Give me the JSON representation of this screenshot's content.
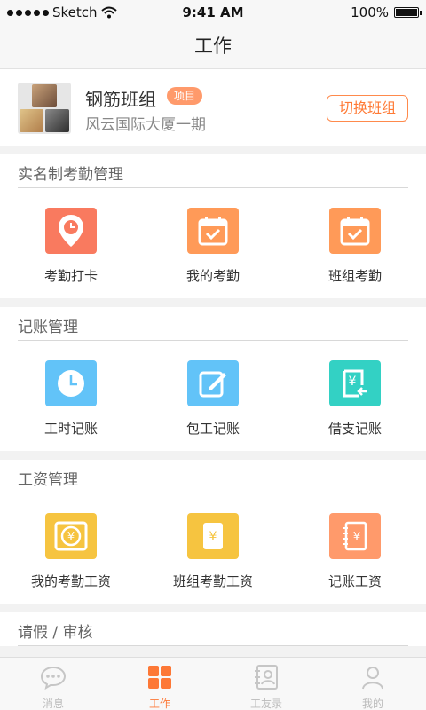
{
  "status": {
    "carrier": "Sketch",
    "time": "9:41 AM",
    "battery": "100%"
  },
  "nav": {
    "title": "工作"
  },
  "team": {
    "name": "钢筋班组",
    "tag": "项目",
    "site": "风云国际大厦一期",
    "switch_label": "切换班组"
  },
  "sections": [
    {
      "title": "实名制考勤管理",
      "items": [
        {
          "label": "考勤打卡",
          "icon": "location-clock-icon",
          "color": "#f97a5f"
        },
        {
          "label": "我的考勤",
          "icon": "calendar-check-icon",
          "color": "#ff9a58"
        },
        {
          "label": "班组考勤",
          "icon": "calendar-check-icon",
          "color": "#ff9a58"
        }
      ]
    },
    {
      "title": "记账管理",
      "items": [
        {
          "label": "工时记账",
          "icon": "clock-icon",
          "color": "#62c3f8"
        },
        {
          "label": "包工记账",
          "icon": "edit-icon",
          "color": "#62c3f8"
        },
        {
          "label": "借支记账",
          "icon": "yuan-return-icon",
          "color": "#33d1c4"
        }
      ]
    },
    {
      "title": "工资管理",
      "items": [
        {
          "label": "我的考勤工资",
          "icon": "yuan-cycle-icon",
          "color": "#f6c440"
        },
        {
          "label": "班组考勤工资",
          "icon": "yuan-book-icon",
          "color": "#f6c440"
        },
        {
          "label": "记账工资",
          "icon": "yuan-notebook-icon",
          "color": "#ff9a6b"
        }
      ]
    },
    {
      "title": "请假 / 审核"
    }
  ],
  "tabs": [
    {
      "label": "消息",
      "icon": "chat-bubble-icon"
    },
    {
      "label": "工作",
      "icon": "grid-icon",
      "active": true
    },
    {
      "label": "工友录",
      "icon": "contacts-book-icon"
    },
    {
      "label": "我的",
      "icon": "person-icon"
    }
  ],
  "colors": {
    "accent": "#ff6b22",
    "tag": "#ff9a6b"
  }
}
